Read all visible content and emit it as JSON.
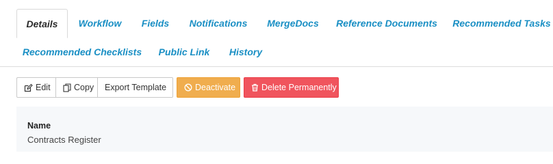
{
  "tabs": [
    {
      "label": "Details",
      "active": true
    },
    {
      "label": "Workflow"
    },
    {
      "label": "Fields"
    },
    {
      "label": "Notifications"
    },
    {
      "label": "MergeDocs"
    },
    {
      "label": "Reference Documents"
    },
    {
      "label": "Recommended Tasks"
    },
    {
      "label": "Recommended Checklists"
    },
    {
      "label": "Public Link"
    },
    {
      "label": "History"
    }
  ],
  "toolbar": {
    "edit_label": "Edit",
    "copy_label": "Copy",
    "export_label": "Export Template",
    "deactivate_label": "Deactivate",
    "delete_label": "Delete Permanently"
  },
  "details": {
    "name_label": "Name",
    "name_value": "Contracts Register"
  },
  "colors": {
    "tab_link": "#1a8fc4",
    "warning": "#f0ad4e",
    "danger": "#f0545d",
    "panel_bg": "#f6f8fa"
  }
}
